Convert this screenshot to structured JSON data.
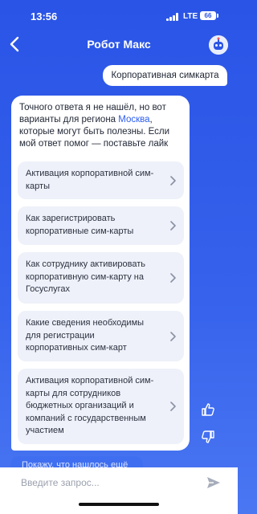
{
  "status": {
    "time": "13:56",
    "network": "LTE",
    "battery": "66"
  },
  "header": {
    "title": "Робот Макс"
  },
  "chat": {
    "user_message": "Корпоративная симкарта",
    "bot_intro_1": "Точного ответа я не нашёл, но вот варианты для региона ",
    "bot_region": "Москва",
    "bot_intro_2": ", которые могут быть полезны. Если мой ответ помог — поставьте лайк",
    "suggestions": [
      {
        "label": "Активация корпоративной сим-карты"
      },
      {
        "label": "Как зарегистрировать корпоративные сим-карты"
      },
      {
        "label": "Как сотруднику активировать корпоративную сим-карту на Госуслугах"
      },
      {
        "label": "Какие сведения необходимы для регистрации корпоративных сим-карт"
      },
      {
        "label": "Активация корпоративной сим-карты для сотрудников бюджетных организаций и компаний с государственным участием"
      }
    ],
    "partial_next": "Покажу, что нашлось ещё"
  },
  "input": {
    "placeholder": "Введите запрос..."
  },
  "icons": {
    "back": "chevron-left-icon",
    "avatar": "robot-avatar-icon",
    "chevron": "chevron-right-icon",
    "like": "thumbs-up-icon",
    "dislike": "thumbs-down-icon",
    "send": "send-icon"
  }
}
